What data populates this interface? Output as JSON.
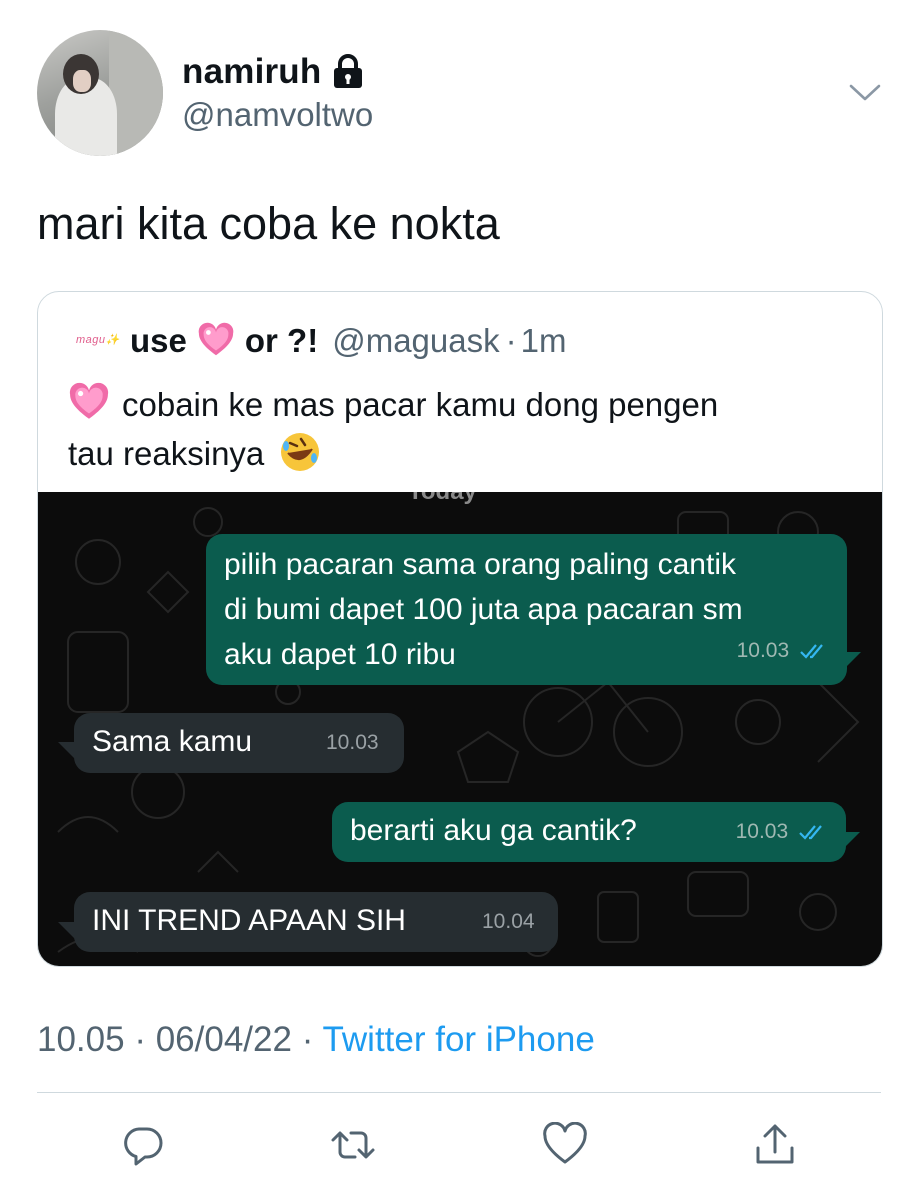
{
  "author": {
    "display_name": "namiruh",
    "handle": "@namvoltwo",
    "protected_icon": "lock-icon",
    "avatar_icon": "avatar"
  },
  "tweet": {
    "text": "mari kita coba ke nokta"
  },
  "quote": {
    "avatar_text": "magu✨",
    "name_part1": "use",
    "name_part2": "or ?!",
    "handle": "@maguask",
    "separator": "·",
    "time": "1m",
    "text_line1": "cobain ke mas pacar kamu dong pengen",
    "text_line2": "tau reaksinya",
    "chat": {
      "day_label": "Today",
      "messages": [
        {
          "side": "out",
          "text_lines": [
            "pilih pacaran sama orang paling cantik",
            "di bumi dapet 100 juta apa pacaran sm",
            "aku dapet 10 ribu"
          ],
          "time": "10.03",
          "read": true
        },
        {
          "side": "in",
          "text": "Sama kamu",
          "time": "10.03"
        },
        {
          "side": "out",
          "text": "berarti aku ga cantik?",
          "time": "10.03",
          "read": true
        },
        {
          "side": "in",
          "text": "INI TREND APAAN SIH",
          "time": "10.04"
        }
      ]
    }
  },
  "meta": {
    "time": "10.05",
    "sep1": "·",
    "date": "06/04/22",
    "sep2": "·",
    "source": "Twitter for iPhone"
  },
  "actions": [
    "reply-icon",
    "retweet-icon",
    "like-icon",
    "share-icon"
  ],
  "colors": {
    "link": "#1d9bf0",
    "secondary_text": "#536471",
    "outgoing_bubble": "#0b5c4e",
    "incoming_bubble": "#262d31",
    "read_ticks": "#34b7f1"
  }
}
